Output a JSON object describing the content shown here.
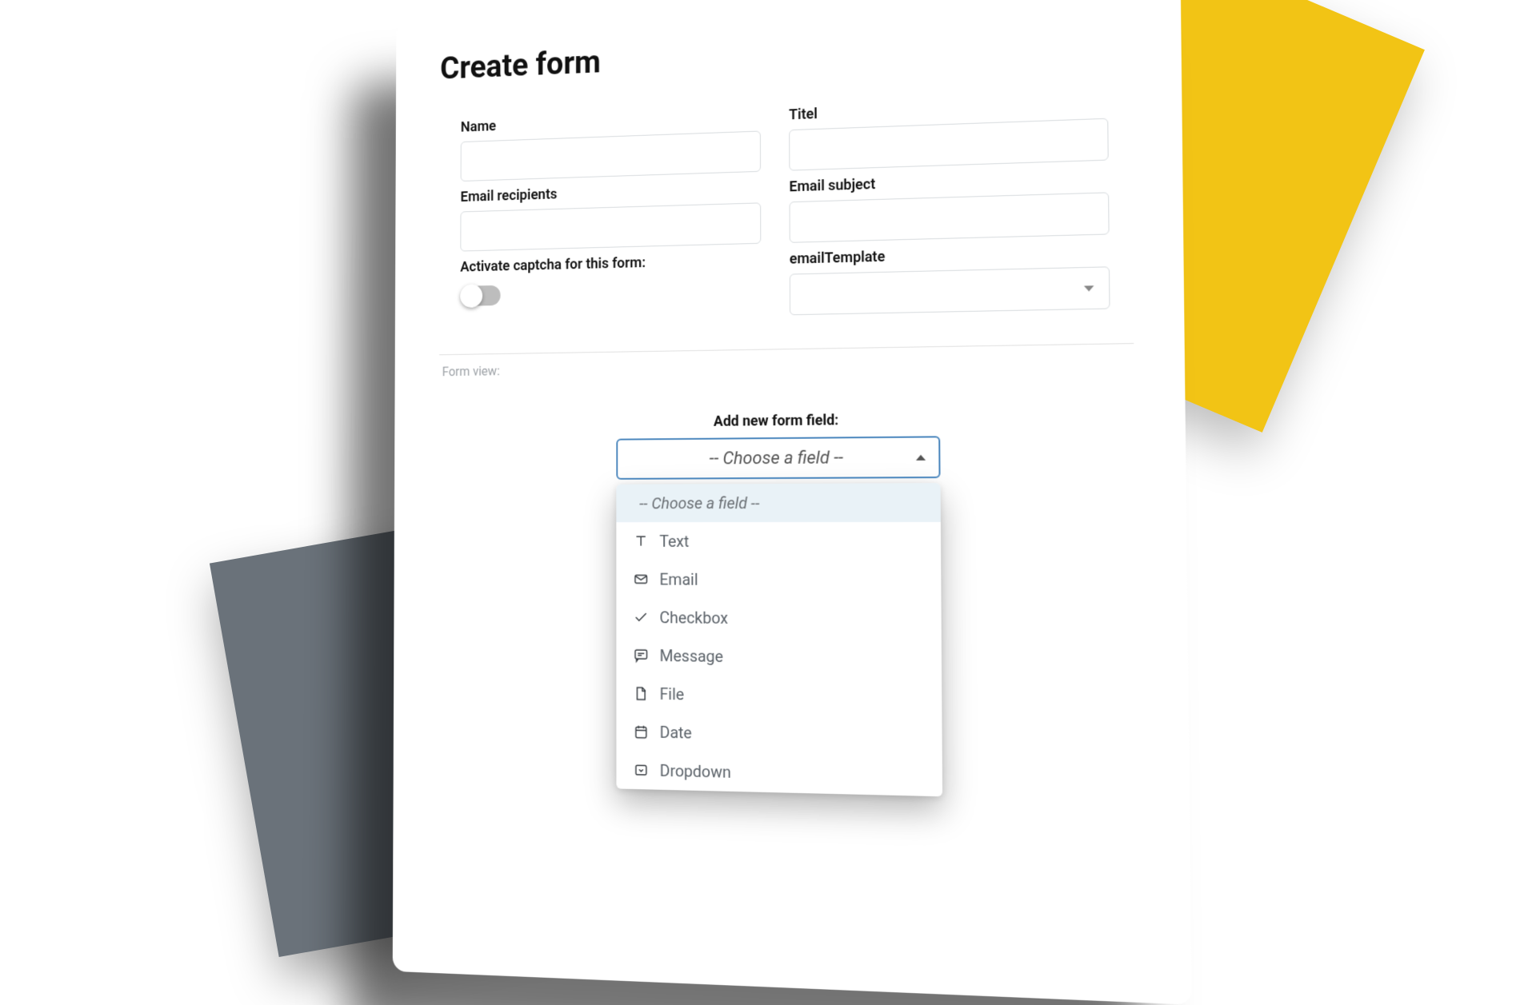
{
  "pageTitle": "Create form",
  "fields": {
    "name": {
      "label": "Name",
      "value": ""
    },
    "titel": {
      "label": "Titel",
      "value": ""
    },
    "emailRecipients": {
      "label": "Email recipients",
      "value": ""
    },
    "emailSubject": {
      "label": "Email subject",
      "value": ""
    },
    "captcha": {
      "label": "Activate captcha for this form:",
      "on": false
    },
    "emailTemplate": {
      "label": "emailTemplate",
      "value": ""
    }
  },
  "formViewLabel": "Form view:",
  "addField": {
    "label": "Add new form field:",
    "placeholder": "-- Choose a field --",
    "options": [
      {
        "icon": "text",
        "label": "Text"
      },
      {
        "icon": "mail",
        "label": "Email"
      },
      {
        "icon": "check",
        "label": "Checkbox"
      },
      {
        "icon": "message",
        "label": "Message"
      },
      {
        "icon": "file",
        "label": "File"
      },
      {
        "icon": "calendar",
        "label": "Date"
      },
      {
        "icon": "dropdown",
        "label": "Dropdown"
      }
    ]
  }
}
